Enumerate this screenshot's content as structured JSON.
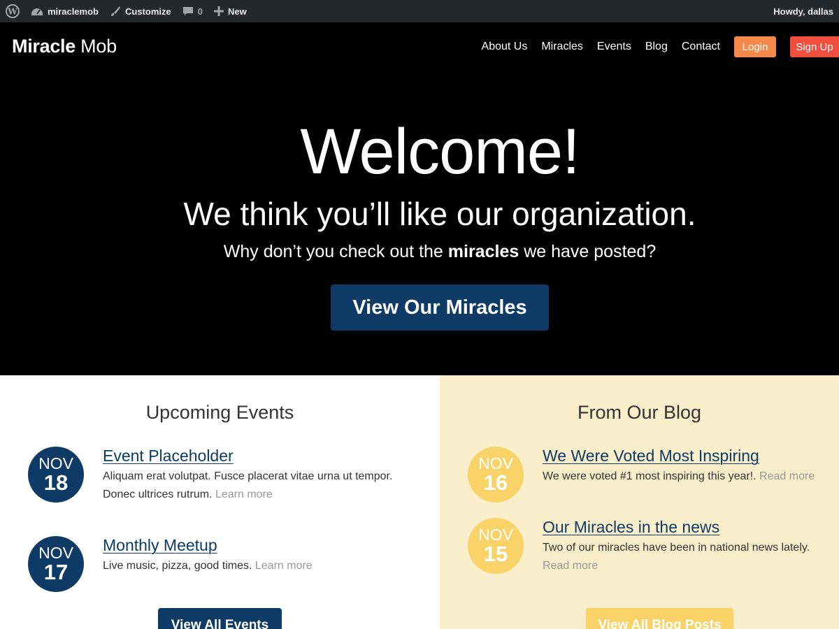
{
  "adminbar": {
    "wp_icon": "wordpress-logo-icon",
    "site_icon": "dashboard-icon",
    "site_name": "miraclemob",
    "customize_icon": "brush-icon",
    "customize_label": "Customize",
    "comments_icon": "comment-bubble-icon",
    "comments_count": "0",
    "new_icon": "plus-icon",
    "new_label": "New",
    "greeting": "Howdy, dallas"
  },
  "header": {
    "logo_bold": "Miracle",
    "logo_light": "Mob",
    "nav": [
      "About Us",
      "Miracles",
      "Events",
      "Blog",
      "Contact"
    ],
    "login_label": "Login",
    "signup_label": "Sign Up"
  },
  "hero": {
    "heading": "Welcome!",
    "subheading": "We think you’ll like our organization.",
    "text_before": "Why don’t you check out the ",
    "text_bold": "miracles",
    "text_after": " we have posted?",
    "button_label": "View Our Miracles"
  },
  "events": {
    "title": "Upcoming Events",
    "items": [
      {
        "month": "NOV",
        "day": "18",
        "title": "Event Placeholder",
        "text": "Aliquam erat volutpat. Fusce placerat vitae urna ut tempor. Donec ultrices rutrum.",
        "more": "Learn more"
      },
      {
        "month": "NOV",
        "day": "17",
        "title": "Monthly Meetup",
        "text": "Live music, pizza, good times.",
        "more": "Learn more"
      }
    ],
    "button_label": "View All Events"
  },
  "blog": {
    "title": "From Our Blog",
    "items": [
      {
        "month": "NOV",
        "day": "16",
        "title": "We Were Voted Most Inspiring",
        "text": "We were voted #1 most inspiring this year!.",
        "more": "Read more"
      },
      {
        "month": "NOV",
        "day": "15",
        "title": "Our Miracles in the news",
        "text": "Two of our miracles have been in national news lately.",
        "more": "Read more"
      }
    ],
    "button_label": "View All Blog Posts"
  },
  "colors": {
    "navy": "#0d3b66",
    "gold": "#f9d367",
    "cream": "#fbeecb",
    "login": "#f5894c",
    "signup": "#f04e3e",
    "adminbar": "#23282d"
  }
}
